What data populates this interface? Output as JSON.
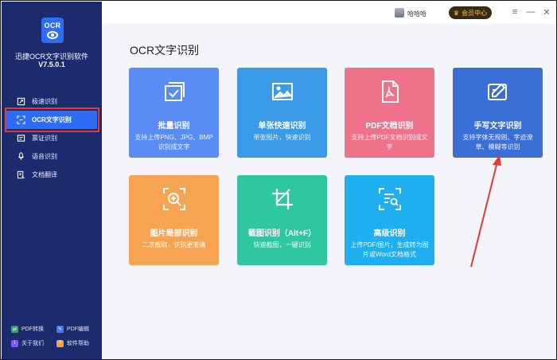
{
  "sidebar": {
    "logo_text": "OCR",
    "app_name": "迅捷OCR文字识别软件",
    "version": "V7.5.0.1",
    "items": [
      {
        "label": "极速识别",
        "icon": "quick-scan-icon"
      },
      {
        "label": "OCR文字识别",
        "icon": "ocr-scan-icon"
      },
      {
        "label": "票证识别",
        "icon": "ticket-icon"
      },
      {
        "label": "语音识别",
        "icon": "microphone-icon"
      },
      {
        "label": "文档翻译",
        "icon": "translate-icon"
      }
    ],
    "active_item": "OCR文字识别",
    "footer": [
      {
        "label": "PDF转换",
        "icon": "pdf-convert-icon",
        "color": "#27a96b"
      },
      {
        "label": "PDF编辑",
        "icon": "pdf-edit-icon",
        "color": "#3d7cf5"
      },
      {
        "label": "关于我们",
        "icon": "about-icon",
        "color": "#7a5af5"
      },
      {
        "label": "软件帮助",
        "icon": "help-icon",
        "color": "#f5a33d"
      }
    ]
  },
  "topbar": {
    "username": "哈哈哈",
    "member_label": "会员中心",
    "window_controls": [
      "≡",
      "—",
      "✕"
    ]
  },
  "main": {
    "title": "OCR文字识别",
    "cards": [
      {
        "title": "批量识别",
        "desc": "支持上传PNG、JPG、BMP识别成文字",
        "icon": "batch-scan-icon",
        "color": "#5a8cf5"
      },
      {
        "title": "单张快速识别",
        "desc": "单张图片，快速识别",
        "icon": "image-icon",
        "color": "#3b9ae8"
      },
      {
        "title": "PDF文档识别",
        "desc": "支持上传PDF文档识别成文字",
        "icon": "pdf-icon",
        "color": "#f0718a"
      },
      {
        "title": "手写文字识别",
        "desc": "支持字体无规则、字迹潦草、模糊等识别",
        "icon": "handwriting-icon",
        "color": "#3a6fd8"
      },
      {
        "title": "图片局部识别",
        "desc": "二次截取，识别更准确",
        "icon": "zoom-scan-icon",
        "color": "#f6a452"
      },
      {
        "title": "截图识别（Alt+F）",
        "desc": "快速截图，一键识别",
        "icon": "crop-icon",
        "color": "#2fc7a0"
      },
      {
        "title": "高级识别",
        "desc": "上传PDF/图片，生成转为图片或Word文档格式",
        "icon": "advanced-scan-icon",
        "color": "#1eaff0"
      }
    ]
  },
  "annotation": {
    "highlight_color": "#e53935",
    "arrow_color": "#e53935"
  }
}
